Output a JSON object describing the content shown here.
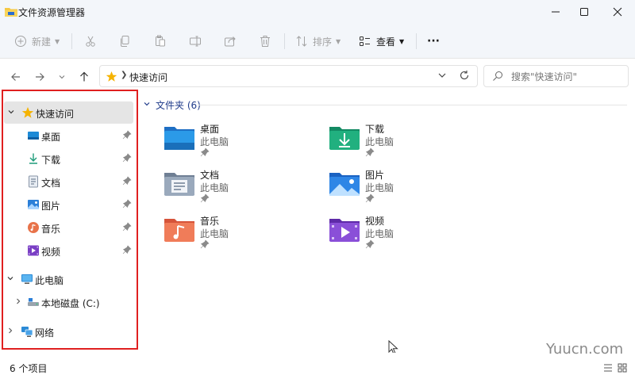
{
  "window": {
    "title": "文件资源管理器"
  },
  "toolbar": {
    "new_label": "新建",
    "sort_label": "排序",
    "view_label": "查看",
    "more_label": "···"
  },
  "address": {
    "path": "快速访问"
  },
  "search": {
    "placeholder": "搜索\"快速访问\""
  },
  "sidebar": {
    "quick_access": "快速访问",
    "items": [
      {
        "label": "桌面",
        "icon": "desktop-icon"
      },
      {
        "label": "下载",
        "icon": "download-icon"
      },
      {
        "label": "文档",
        "icon": "document-icon"
      },
      {
        "label": "图片",
        "icon": "picture-icon"
      },
      {
        "label": "音乐",
        "icon": "music-icon"
      },
      {
        "label": "视频",
        "icon": "video-icon"
      }
    ],
    "this_pc": "此电脑",
    "local_disk": "本地磁盘 (C:)",
    "network": "网络"
  },
  "content": {
    "group_title": "文件夹 (6)",
    "folders": [
      {
        "name": "桌面",
        "sub": "此电脑"
      },
      {
        "name": "下载",
        "sub": "此电脑"
      },
      {
        "name": "文档",
        "sub": "此电脑"
      },
      {
        "name": "图片",
        "sub": "此电脑"
      },
      {
        "name": "音乐",
        "sub": "此电脑"
      },
      {
        "name": "视频",
        "sub": "此电脑"
      }
    ]
  },
  "status": {
    "count": "6 个项目"
  },
  "watermark": "Yuucn.com",
  "colors": {
    "accent": "#1f3b8a",
    "highlight_frame": "#e02020",
    "selected_bg": "#e5e5e5",
    "chrome_bg": "#f3f6fa"
  }
}
